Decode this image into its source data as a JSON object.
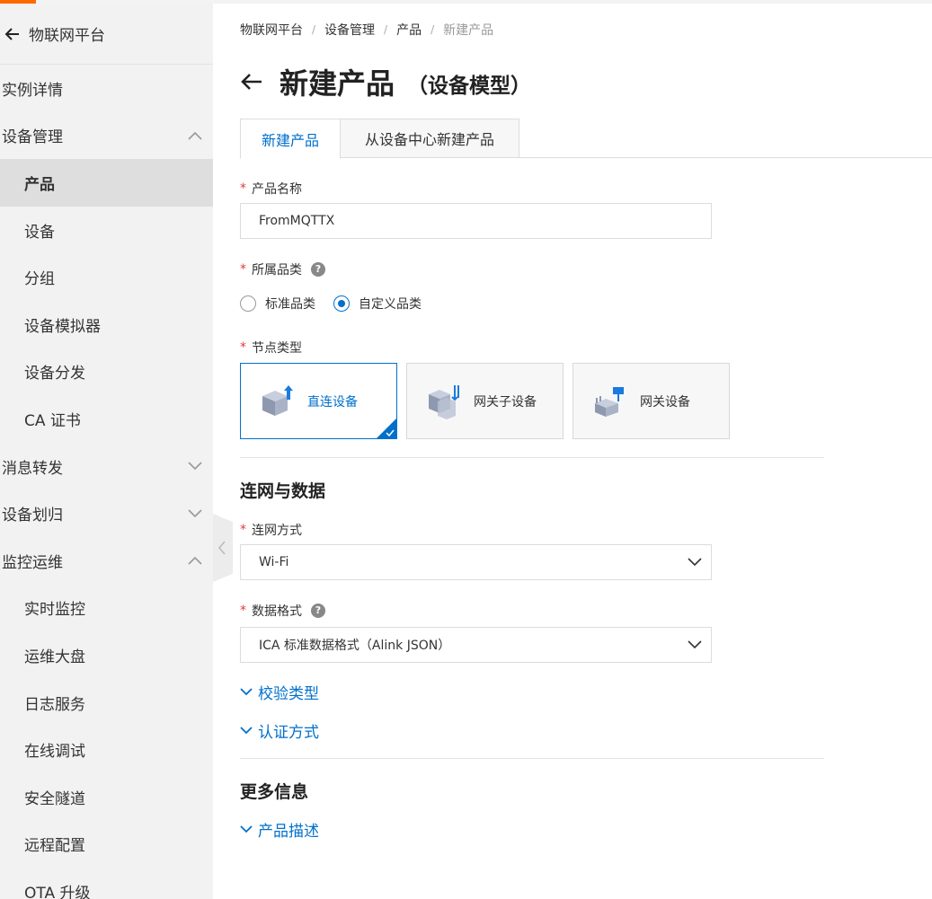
{
  "sidebar": {
    "title": "物联网平台",
    "items": [
      {
        "label": "实例详情"
      },
      {
        "label": "设备管理"
      },
      {
        "label": "产品"
      },
      {
        "label": "设备"
      },
      {
        "label": "分组"
      },
      {
        "label": "设备模拟器"
      },
      {
        "label": "设备分发"
      },
      {
        "label": "CA 证书"
      },
      {
        "label": "消息转发"
      },
      {
        "label": "设备划归"
      },
      {
        "label": "监控运维"
      },
      {
        "label": "实时监控"
      },
      {
        "label": "运维大盘"
      },
      {
        "label": "日志服务"
      },
      {
        "label": "在线调试"
      },
      {
        "label": "安全隧道"
      },
      {
        "label": "远程配置"
      },
      {
        "label": "OTA 升级"
      }
    ]
  },
  "breadcrumb": [
    "物联网平台",
    "设备管理",
    "产品",
    "新建产品"
  ],
  "page": {
    "title": "新建产品",
    "subtitle": "（设备模型）"
  },
  "tabs": [
    {
      "label": "新建产品"
    },
    {
      "label": "从设备中心新建产品"
    }
  ],
  "form": {
    "product_name": {
      "label": "产品名称",
      "value": "FromMQTTX"
    },
    "category": {
      "label": "所属品类",
      "options": [
        "标准品类",
        "自定义品类"
      ],
      "selected": "自定义品类"
    },
    "node_type": {
      "label": "节点类型",
      "options": [
        "直连设备",
        "网关子设备",
        "网关设备"
      ],
      "selected": "直连设备"
    },
    "network_section": "连网与数据",
    "network": {
      "label": "连网方式",
      "value": "Wi-Fi"
    },
    "data_format": {
      "label": "数据格式",
      "value": "ICA 标准数据格式（Alink JSON）"
    },
    "verify_type": "校验类型",
    "auth_method": "认证方式",
    "more_section": "更多信息",
    "product_desc": "产品描述"
  },
  "colors": {
    "accent": "#0070cc",
    "required": "#e4393c",
    "brand": "#ff6a00"
  }
}
